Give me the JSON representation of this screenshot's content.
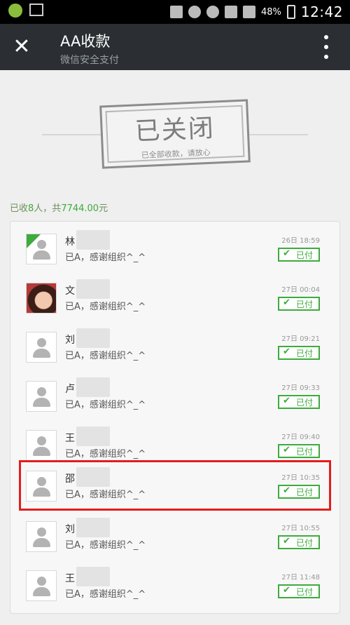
{
  "status_bar": {
    "battery": "48%",
    "time": "12:42"
  },
  "header": {
    "close_icon": "close-icon",
    "title": "AA收款",
    "subtitle": "微信安全支付",
    "more_icon": "more-vertical-icon"
  },
  "stamp": {
    "title": "已关闭",
    "subtitle": "已全部收款，请放心"
  },
  "summary": {
    "prefix": "已收",
    "count": "8",
    "mid": "人，共",
    "amount": "7744.00",
    "suffix": "元"
  },
  "records": [
    {
      "name": "林",
      "message": "已A，感谢组织^_^",
      "time": "26日 18:59",
      "status": "已付",
      "avatar": "wechat-badge"
    },
    {
      "name": "文",
      "message": "已A，感谢组织^_^",
      "time": "27日 00:04",
      "status": "已付",
      "avatar": "photo"
    },
    {
      "name": "刘",
      "message": "已A，感谢组织^_^",
      "time": "27日 09:21",
      "status": "已付",
      "avatar": "default"
    },
    {
      "name": "卢",
      "message": "已A，感谢组织^_^",
      "time": "27日 09:33",
      "status": "已付",
      "avatar": "default"
    },
    {
      "name": "王",
      "message": "已A，感谢组织^_^",
      "time": "27日 09:40",
      "status": "已付",
      "avatar": "default"
    },
    {
      "name": "邵",
      "message": "已A，感谢组织^_^",
      "time": "27日 10:35",
      "status": "已付",
      "avatar": "default"
    },
    {
      "name": "刘",
      "message": "已A，感谢组织^_^",
      "time": "27日 10:55",
      "status": "已付",
      "avatar": "default"
    },
    {
      "name": "王",
      "message": "已A，感谢组织^_^",
      "time": "27日 11:48",
      "status": "已付",
      "avatar": "default"
    }
  ],
  "highlighted_record": 5,
  "colors": {
    "accent_green": "#3dab3d",
    "highlight_red": "#e21d1d",
    "header_bg": "#2b2f33"
  }
}
